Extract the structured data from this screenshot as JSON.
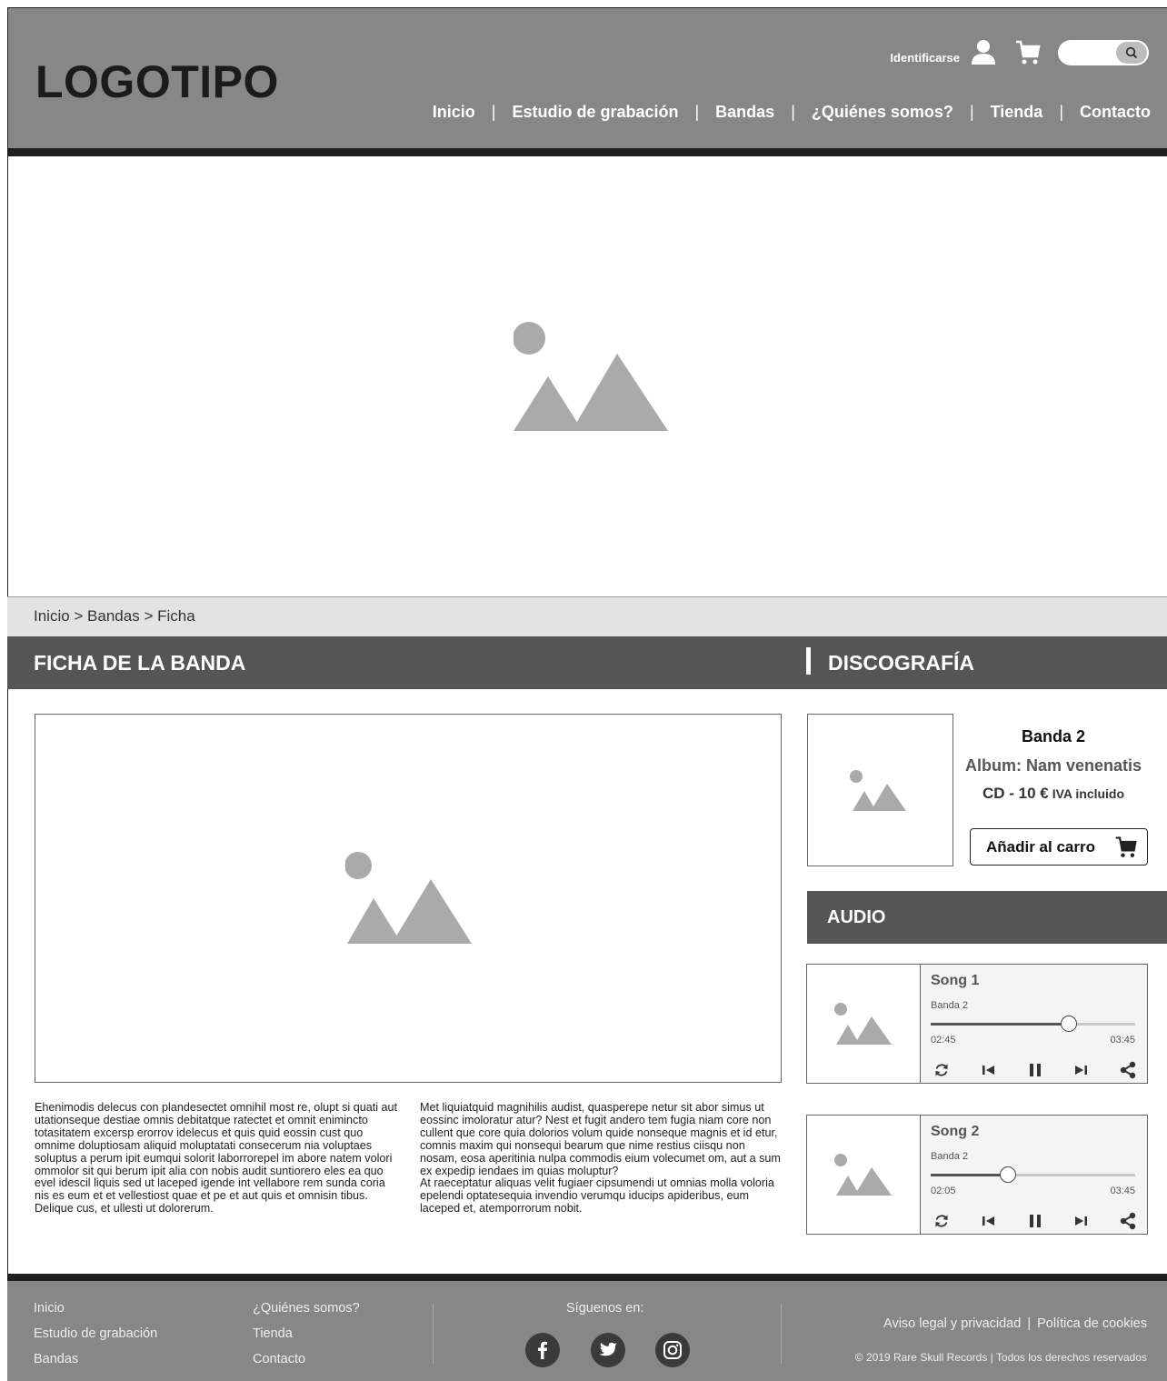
{
  "header": {
    "logo": "LOGOTIPO",
    "login_label": "Identificarse",
    "icons": {
      "user": "user-icon",
      "cart": "cart-icon",
      "search": "search-icon"
    },
    "nav": [
      "Inicio",
      "Estudio de grabación",
      "Bandas",
      "¿Quiénes somos?",
      "Tienda",
      "Contacto"
    ],
    "nav_separator": "|"
  },
  "breadcrumb": "Inicio > Bandas > Ficha",
  "band_section": {
    "title": "FICHA DE LA BANDA",
    "text_col1": "Ehenimodis delecus con plandesectet omnihil most re, olupt si quati aut utationseque destiae omnis debitatque ratectet et omnit enimincto totasitatem excersp erorrov idelecus et quis quid eossin cust quo omnime doluptiosam aliquid moluptatati consecerum nia voluptaes soluptus a perum ipit eumqui solorit laborrorepel im abore natem volori ommolor sit qui berum ipit alia con nobis audit suntiorero eles ea quo evel idescil liquis sed ut laceped igende int vellabore rem sunda coria nis es eum et et vellestiost quae et pe et aut quis et omnisin tibus. Delique cus, et ullesti ut dolorerum.",
    "text_col2_p1": "Met liquiatquid magnihilis audist, quasperepe netur sit abor simus ut eossinc imoloratur atur? Nest et fugit andero tem fugia niam core non cullent que core quia dolorios volum quide nonseque magnis et id etur, comnis maxim qui nonsequi bearum que nime restius ciisqu non nosam, eosa aperitinia nulpa commodis eium volecumet om, aut a sum ex expedip iendaes im quias moluptur?",
    "text_col2_p2": "At raeceptatur aliquas velit fugiaer cipsumendi ut omnias molla voloria epelendi optatesequia invendio verumqu iducips apideribus, eum laceped et, atemporrorum nobit."
  },
  "discography": {
    "title": "DISCOGRAFÍA",
    "album": {
      "band": "Banda 2",
      "album": "Album: Nam venenatis",
      "price": "CD - 10 €",
      "vat": "IVA incluido",
      "add_to_cart": "Añadir al carro"
    }
  },
  "audio": {
    "title": "AUDIO",
    "tracks": [
      {
        "title": "Song 1",
        "band": "Banda 2",
        "current": "02:45",
        "total": "03:45",
        "progress": 0.676
      },
      {
        "title": "Song 2",
        "band": "Banda 2",
        "current": "02:05",
        "total": "03:45",
        "progress": 0.378
      }
    ],
    "control_icons": [
      "repeat-icon",
      "previous-icon",
      "pause-icon",
      "next-icon",
      "share-icon"
    ]
  },
  "footer": {
    "links_col1": [
      "Inicio",
      "Estudio de grabación",
      "Bandas"
    ],
    "links_col2": [
      "¿Quiénes somos?",
      "Tienda",
      "Contacto"
    ],
    "follow_label": "Síguenos en:",
    "social_icons": [
      "facebook-icon",
      "twitter-icon",
      "instagram-icon"
    ],
    "legal": "Aviso legal y privacidad",
    "legal_separator": "|",
    "cookies": "Política de cookies",
    "copyright": "© 2019 Rare Skull Records | Todos los derechos reservados"
  },
  "colors": {
    "header_bg": "#878787",
    "section_header_bg": "#555555",
    "breadcrumb_bg": "#e3e3e3",
    "placeholder": "#aaaaaa",
    "dark_bar": "#1f1f1f"
  }
}
